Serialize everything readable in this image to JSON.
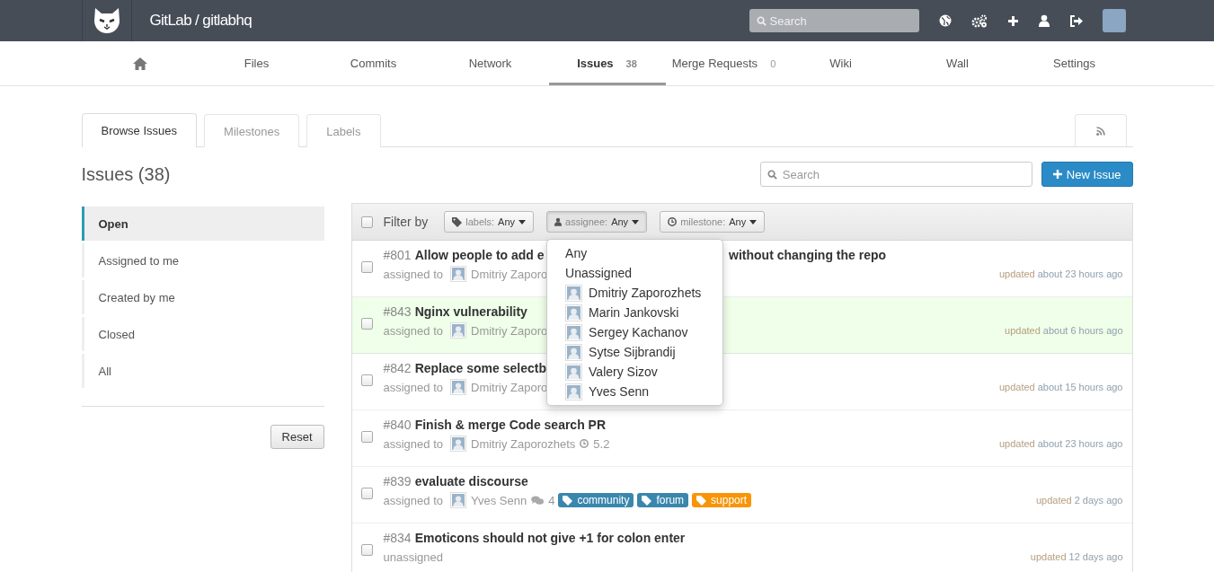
{
  "header": {
    "title": "GitLab / gitlabhq",
    "search": {
      "placeholder": "Search"
    }
  },
  "nav": [
    {
      "kind": "home",
      "selected": false
    },
    {
      "kind": "text",
      "label": "Files",
      "selected": false
    },
    {
      "kind": "text",
      "label": "Commits",
      "selected": false
    },
    {
      "kind": "text",
      "label": "Network",
      "selected": false
    },
    {
      "kind": "text",
      "label": "Issues",
      "count": "38",
      "selected": true
    },
    {
      "kind": "text",
      "label": "Merge Requests",
      "count": "0",
      "selected": false
    },
    {
      "kind": "text",
      "label": "Wiki",
      "selected": false
    },
    {
      "kind": "text",
      "label": "Wall",
      "selected": false
    },
    {
      "kind": "text",
      "label": "Settings",
      "selected": false
    }
  ],
  "tabs": [
    {
      "label": "Browse Issues",
      "selected": true
    },
    {
      "label": "Milestones",
      "selected": false
    },
    {
      "label": "Labels",
      "selected": false
    }
  ],
  "page": {
    "title": "Issues (38)",
    "search": {
      "placeholder": "Search"
    },
    "new_button": "New Issue"
  },
  "sidebar": {
    "items": [
      {
        "label": "Open",
        "selected": true
      },
      {
        "label": "Assigned to me",
        "selected": false
      },
      {
        "label": "Created by me",
        "selected": false
      },
      {
        "label": "Closed",
        "selected": false
      },
      {
        "label": "All",
        "selected": false
      }
    ],
    "reset": "Reset"
  },
  "filter": {
    "label": "Filter by",
    "checked": false,
    "dropdowns": [
      {
        "kind": "labels",
        "name": "labels:",
        "value": "Any",
        "expanded": false
      },
      {
        "kind": "assignee",
        "name": "assignee:",
        "value": "Any",
        "expanded": true,
        "menu": [
          {
            "kind": "plain",
            "label": "Any"
          },
          {
            "kind": "plain",
            "label": "Unassigned"
          },
          {
            "kind": "user",
            "label": "Dmitriy Zaporozhets"
          },
          {
            "kind": "user",
            "label": "Marin Jankovski"
          },
          {
            "kind": "user",
            "label": "Sergey Kachanov"
          },
          {
            "kind": "user",
            "label": "Sytse Sijbrandij"
          },
          {
            "kind": "user",
            "label": "Valery Sizov"
          },
          {
            "kind": "user",
            "label": "Yves Senn"
          }
        ]
      },
      {
        "kind": "milestone",
        "name": "milestone:",
        "value": "Any",
        "expanded": false
      }
    ]
  },
  "issues": [
    {
      "number": "#801",
      "title": "Allow people to add e",
      "title_end": "without changing the repo",
      "assignee_label": "assigned to",
      "assignee": "Dmitriy Zaporo",
      "updated": "updated",
      "time": "about 23 hours ago",
      "highlighted": false,
      "checked": false
    },
    {
      "number": "#843",
      "title": "Nginx vulnerability",
      "assignee_label": "assigned to",
      "assignee": "Dmitriy Zaporo",
      "updated": "updated",
      "time": "about 6 hours ago",
      "highlighted": true,
      "checked": false
    },
    {
      "number": "#842",
      "title": "Replace some selectb",
      "assignee_label": "assigned to",
      "assignee": "Dmitriy Zaporo",
      "updated": "updated",
      "time": "about 15 hours ago",
      "highlighted": false,
      "checked": false
    },
    {
      "number": "#840",
      "title": "Finish & merge Code search PR",
      "assignee_label": "assigned to",
      "assignee": "Dmitriy Zaporozhets",
      "milestone": "5.2",
      "updated": "updated",
      "time": "about 23 hours ago",
      "highlighted": false,
      "checked": false
    },
    {
      "number": "#839",
      "title": "evaluate discourse",
      "assignee_label": "assigned to",
      "assignee": "Yves Senn",
      "comments": "4",
      "labels": [
        {
          "name": "community",
          "color": "#3a87ad"
        },
        {
          "name": "forum",
          "color": "#3a87ad"
        },
        {
          "name": "support",
          "color": "#f89406"
        }
      ],
      "updated": "updated",
      "time": "2 days ago",
      "highlighted": false,
      "checked": false
    },
    {
      "number": "#834",
      "title": "Emoticons should not give +1 for colon enter",
      "assignee_label": "unassigned",
      "updated": "updated",
      "time": "12 days ago",
      "highlighted": false,
      "checked": false
    }
  ]
}
